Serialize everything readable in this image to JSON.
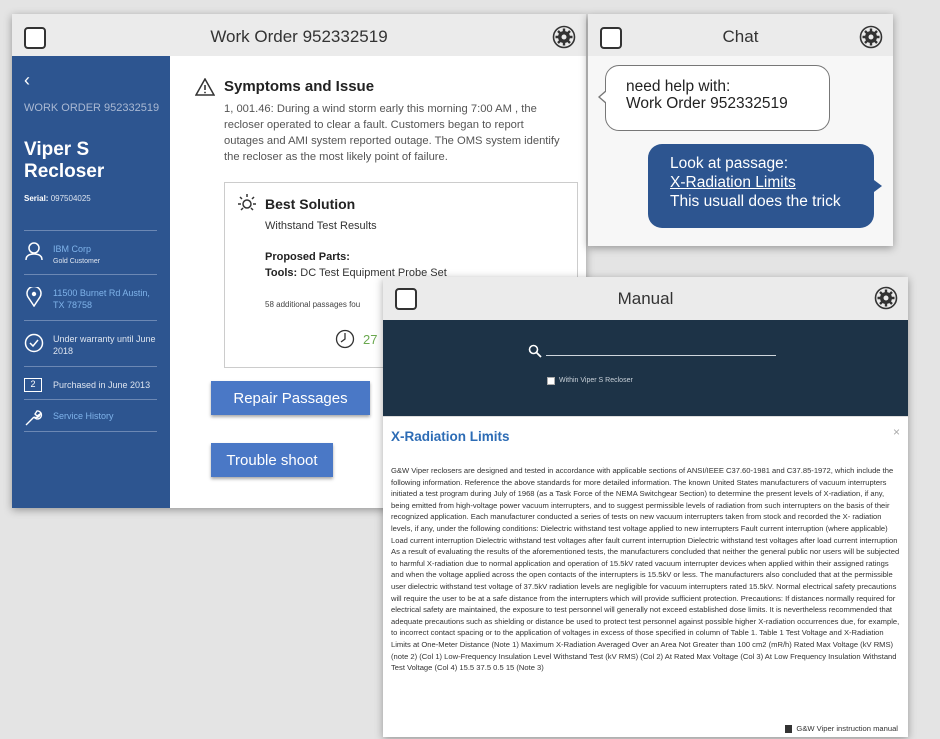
{
  "work_order_window": {
    "title": "Work Order 952332519",
    "sidebar": {
      "back_glyph": "‹",
      "wo_label": "WORK ORDER 952332519",
      "model": "Viper S Recloser",
      "serial_label": "Serial:",
      "serial_value": "097504025",
      "rows": [
        {
          "icon": "person-icon",
          "title": "IBM Corp",
          "subtitle": "Gold Customer"
        },
        {
          "icon": "location-pin-icon",
          "title": "11500 Burnet Rd Austin, TX 78758"
        },
        {
          "icon": "check-circle-icon",
          "text": "Under warranty until June 2018"
        },
        {
          "icon": "calendar-icon",
          "calendar_num": "2",
          "text": "Purchased in June 2013"
        },
        {
          "icon": "wrench-icon",
          "title": "Service History"
        }
      ]
    },
    "symptoms": {
      "title": "Symptoms and Issue",
      "text": "1, 001.46: During a wind storm early this morning 7:00 AM , the recloser operated to clear a fault. Customers began to report outages and AMI system reported outage. The OMS system identify the recloser as the most likely point of failure."
    },
    "best_solution": {
      "title": "Best Solution",
      "subtitle": "Withstand Test Results",
      "proposed_parts_label": "Proposed Parts:",
      "tools_label": "Tools:",
      "tools_value": "DC Test Equipment Probe Set",
      "more_text": "58 additional passages fou",
      "count": "27"
    },
    "buttons": {
      "repair": "Repair Passages",
      "trouble": "Trouble shoot"
    }
  },
  "chat_window": {
    "title": "Chat",
    "incoming": {
      "line1": "need help with:",
      "line2": "Work Order 952332519"
    },
    "outgoing": {
      "line1": "Look at passage:",
      "link": "X-Radiation Limits",
      "line3": "This usuall does the trick"
    }
  },
  "manual_window": {
    "title": "Manual",
    "search": {
      "value": "",
      "checkbox_label": "Within Viper S Recloser"
    },
    "article": {
      "title": "X-Radiation Limits",
      "close_glyph": "×",
      "body": "G&W Viper reclosers are designed and tested in accordance with applicable sections of ANSI/IEEE C37.60-1981 and C37.85-1972, which include the following information. Reference the above standards for more detailed information. The known United States manufacturers of vacuum interrupters initiated a test program during July of 1968 (as a Task Force of the NEMA Switchgear Section) to determine the present levels of X-radiation, if any, being emitted from high-voltage power vacuum interrupters, and to suggest permissible levels of radiation from such interrupters on the basis of their recognized application. Each manufacturer conducted a series of tests on new vacuum interrupters taken from stock and recorded the X- radiation levels, if any, under the following conditions: Dielectric withstand test voltage applied to new interrupters Fault current interruption (where applicable) Load current interruption Dielectric withstand test voltages after fault current interruption Dielectric withstand test voltages after load current interruption As a result of evaluating the results of the aforementioned tests, the manufacturers concluded that neither the general public nor users will be subjected to harmful X-radiation due to normal application and operation of 15.5kV rated vacuum interrupter devices when applied within their assigned ratings and when the voltage applied across the open contacts of the interrupters is 15.5kV or less. The manufacturers also concluded that at the permissible user dielectric withstand test voltage of 37.5kV radiation levels are negligible for vacuum interrupters rated 15.5kV. Normal electrical safety precautions will require the user to be at a safe distance from the interrupters which will provide sufficient protection. Precautions: If distances normally required for electrical safety are maintained, the exposure to test personnel will generally not exceed established dose limits. It is nevertheless recommended that adequate precautions such as shielding or distance be used to protect test personnel against possible higher X-radiation occurrences due, for example, to incorrect contact spacing or to the application of voltages in excess of those specified in column of Table 1. Table 1 Test Voltage and X-Radiation Limits at One-Meter Distance (Note 1) Maximum X-Radiation Averaged Over an Area Not Greater than 100 cm2 (mR/h) Rated Max Voltage (kV RMS) (note 2) (Col 1) Low-Frequency Insulation Level Withstand Test (kV RMS) (Col 2) At Rated Max Voltage (Col 3) At Low Frequency Insulation Withstand Test Voltage (Col 4) 15.5 37.5 0.5 15 (Note 3)",
      "footer": "G&W Viper instruction manual"
    }
  },
  "colors": {
    "sidebar": "#2d5590",
    "button": "#4a78c6",
    "chat_bubble": "#2d5590",
    "manual_header": "#1d3347",
    "article_title": "#2d6cb5",
    "accent_green": "#6aa84f"
  }
}
